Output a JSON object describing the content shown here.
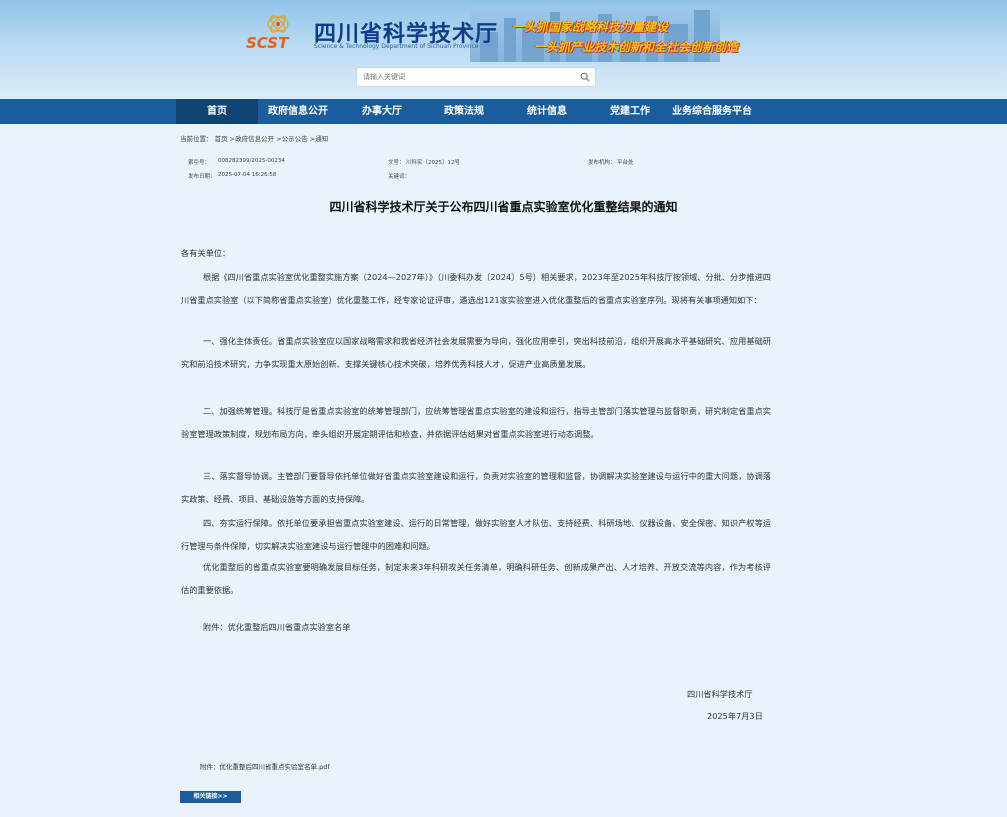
{
  "header": {
    "logo_mark": "SCST",
    "site_title": "四川省科学技术厅",
    "site_title_en": "Science & Technology Department of Sichuan Province",
    "slogan_1": "一头抓国家战略科技力量建设",
    "slogan_2": "一头抓产业技术创新和全社会创新创造",
    "search_placeholder": "请输入关键词"
  },
  "nav": {
    "items": [
      {
        "label": "首页"
      },
      {
        "label": "政府信息公开"
      },
      {
        "label": "办事大厅"
      },
      {
        "label": "政策法规"
      },
      {
        "label": "统计信息"
      },
      {
        "label": "党建工作"
      },
      {
        "label": "业务综合服务平台"
      }
    ]
  },
  "breadcrumb": {
    "prefix": "当前位置：",
    "home": "首页",
    "sep": " >",
    "gov": "政府信息公开",
    "notice": "公示公告",
    "current": "通知"
  },
  "meta": {
    "index_label": "索引号：",
    "index_value": "008282399/2025-00234",
    "docno_label": "文号：",
    "docno_value": "川科实〔2025〕12号",
    "publisher_label": "发布机构：",
    "publisher_value": "平台处",
    "date_label": "发布日期：",
    "date_value": "2025-07-04 16:26:58",
    "keywords_label": "关键词："
  },
  "article": {
    "title": "四川省科学技术厅关于公布四川省重点实验室优化重整结果的通知",
    "salutation": "各有关单位：",
    "p1": "根据《四川省重点实验室优化重整实施方案（2024—2027年）》（川委科办发〔2024〕5号）相关要求，2023年至2025年科技厅按领域、分批、分步推进四川省重点实验室（以下简称省重点实验室）优化重整工作，经专家论证评审，遴选出121家实验室进入优化重整后的省重点实验室序列。现将有关事项通知如下：",
    "p2": "一、强化主体责任。省重点实验室应以国家战略需求和我省经济社会发展需要为导向，强化应用牵引，突出科技前沿，组织开展高水平基础研究、应用基础研究和前沿技术研究，力争实现重大原始创新、支撑关键核心技术突破，培养优秀科技人才，促进产业高质量发展。",
    "p3": "二、加强统筹管理。科技厅是省重点实验室的统筹管理部门，应统筹管理省重点实验室的建设和运行，指导主管部门落实管理与监督职责，研究制定省重点实验室管理政策制度，规划布局方向，牵头组织开展定期评估和检查，并依据评估结果对省重点实验室进行动态调整。",
    "p4": "三、落实督导协调。主管部门要督导依托单位做好省重点实验室建设和运行，负责对实验室的管理和监督，协调解决实验室建设与运行中的重大问题，协调落实政策、经费、项目、基础设施等方面的支持保障。",
    "p5": "四、夯实运行保障。依托单位要承担省重点实验室建设、运行的日常管理，做好实验室人才队伍、支持经费、科研场地、仪器设备、安全保密、知识产权等运行管理与条件保障，切实解决实验室建设与运行管理中的困难和问题。",
    "p6": "优化重整后的省重点实验室要明确发展目标任务，制定未来3年科研攻关任务清单，明确科研任务、创新成果产出、人才培养、开放交流等内容，作为考核评估的重要依据。",
    "attachment_line": "附件：优化重整后四川省重点实验室名单",
    "sign_org": "四川省科学技术厅",
    "sign_date": "2025年7月3日",
    "attachment_file": "附件：优化重整后四川省重点实验室名单.pdf",
    "related_button": "相关链接>>"
  }
}
